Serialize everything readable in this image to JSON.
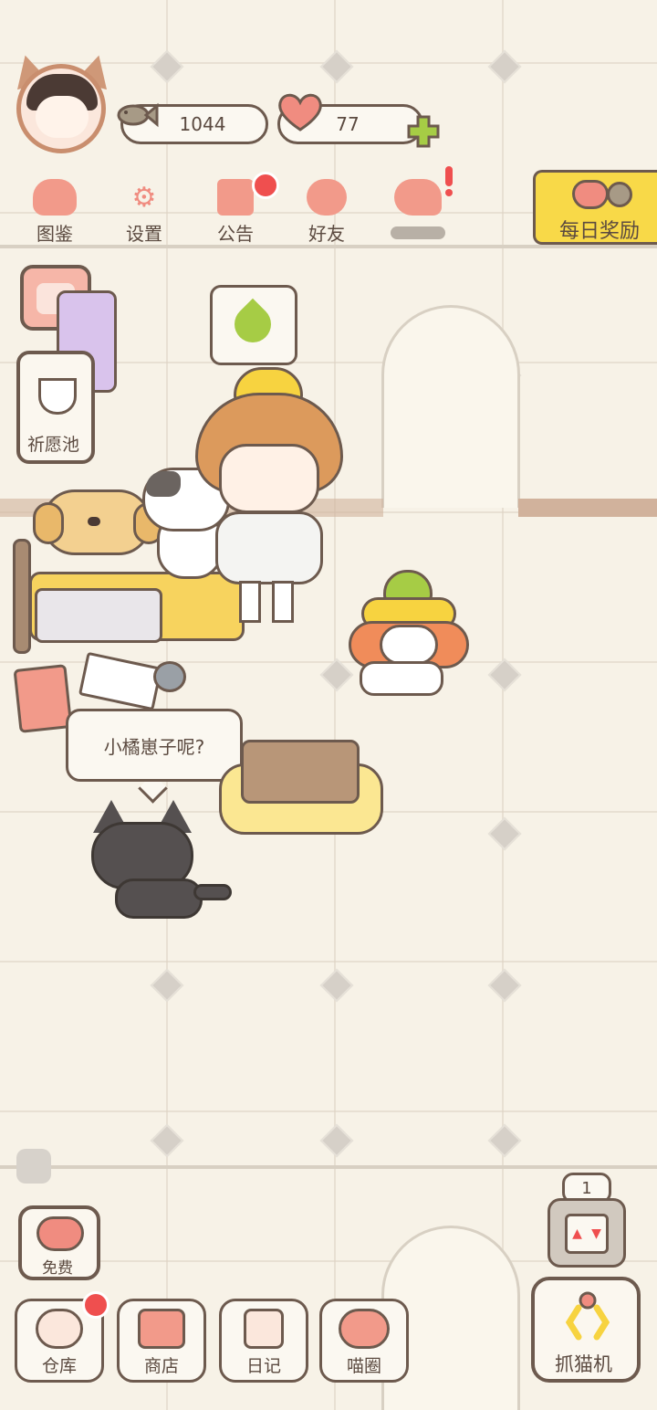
{
  "hud": {
    "fish_count": "1044",
    "heart_count": "77",
    "plus_icon": "+"
  },
  "top_menu": [
    {
      "label": "图鉴",
      "icon": "cat-book-icon"
    },
    {
      "label": "设置",
      "icon": "gear-icon"
    },
    {
      "label": "公告",
      "icon": "gift-icon"
    },
    {
      "label": "好友",
      "icon": "friends-icon"
    },
    {
      "label": "",
      "icon": "heart-send-icon"
    }
  ],
  "daily_reward": {
    "label": "每日奖励"
  },
  "side": {
    "wish_pool_label": "祈愿池"
  },
  "scene": {
    "speech": "小橘崽子呢?"
  },
  "bottom": {
    "free_label": "免费",
    "floor_number": "1",
    "claw_machine_label": "抓猫机",
    "nav": [
      {
        "label": "仓库",
        "icon": "warehouse-icon"
      },
      {
        "label": "商店",
        "icon": "shop-icon"
      },
      {
        "label": "日记",
        "icon": "diary-icon"
      },
      {
        "label": "喵圈",
        "icon": "cat-planet-icon"
      }
    ]
  },
  "colors": {
    "outline": "#6d5a4e",
    "accent_pink": "#f08c80",
    "accent_yellow": "#f8d948",
    "badge_red": "#ef4f4f",
    "plus_green": "#a6cc45"
  }
}
